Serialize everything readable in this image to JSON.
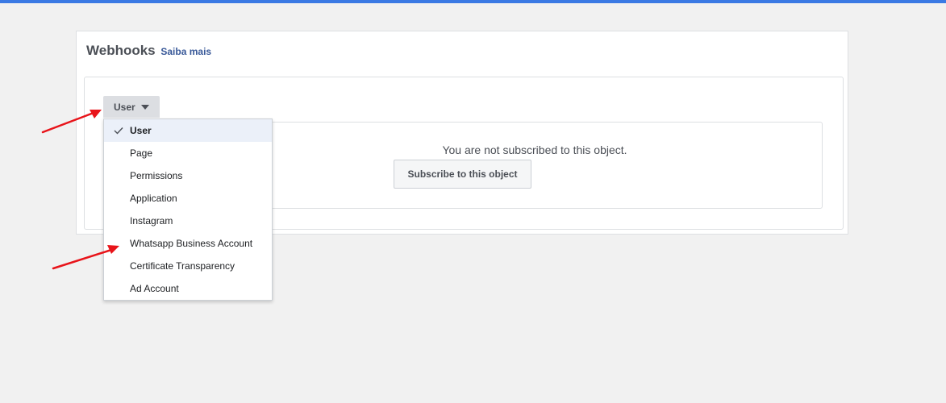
{
  "header": {
    "title": "Webhooks",
    "learn_more": "Saiba mais"
  },
  "object_select": {
    "value": "User"
  },
  "dropdown": {
    "items": [
      {
        "label": "User",
        "selected": true
      },
      {
        "label": "Page",
        "selected": false
      },
      {
        "label": "Permissions",
        "selected": false
      },
      {
        "label": "Application",
        "selected": false
      },
      {
        "label": "Instagram",
        "selected": false
      },
      {
        "label": "Whatsapp Business Account",
        "selected": false
      },
      {
        "label": "Certificate Transparency",
        "selected": false
      },
      {
        "label": "Ad Account",
        "selected": false
      }
    ]
  },
  "subscription": {
    "message": "You are not subscribed to this object.",
    "button_label": "Subscribe to this object"
  },
  "colors": {
    "top_bar": "#3b7ae4",
    "link": "#385898",
    "annotation_arrow": "#e8141a",
    "selected_item_bg": "#ebf0f9"
  }
}
